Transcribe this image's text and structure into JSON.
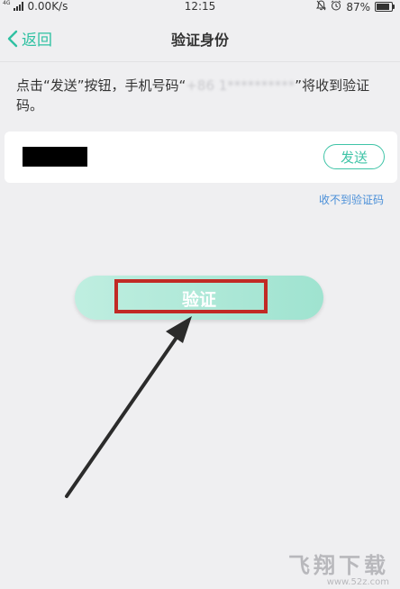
{
  "status_bar": {
    "network_type": "4G",
    "speed": "0.00K/s",
    "time": "12:15",
    "battery": "87%",
    "battery_level": 0.87
  },
  "header": {
    "back_label": "返回",
    "title": "验证身份"
  },
  "instruction": {
    "before": "点击“发送”按钮，手机号码“",
    "phone_masked": "+86 1**********",
    "after": "”将收到验证码。"
  },
  "code_row": {
    "send_label": "发送"
  },
  "no_code_link": "收不到验证码",
  "verify_label": "验证",
  "watermark": {
    "brand": "飞翔下载",
    "url": "www.52z.com"
  },
  "colors": {
    "accent": "#2fc1a2",
    "link": "#4a8fd8",
    "highlight": "#c12a25"
  }
}
